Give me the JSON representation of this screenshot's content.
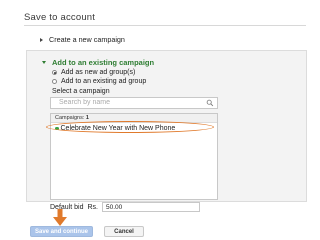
{
  "dialog": {
    "title": "Save to account"
  },
  "create": {
    "label": "Create a new campaign"
  },
  "existing": {
    "heading": "Add to an existing campaign",
    "options": [
      {
        "label": "Add as new ad group(s)",
        "selected": true
      },
      {
        "label": "Add to an existing ad group",
        "selected": false
      }
    ],
    "select_label": "Select a campaign",
    "search_placeholder": "Search by name",
    "list_header_label": "Campaigns:",
    "list_count": "1",
    "campaigns": [
      {
        "name": "Celebrate New Year with New Phone",
        "status_color": "#3aa142",
        "highlighted": true
      }
    ]
  },
  "bid": {
    "label": "Default bid",
    "currency": "Rs.",
    "value": "50.00"
  },
  "buttons": {
    "primary": "Save and continue",
    "secondary": "Cancel"
  },
  "annotation": {
    "arrow_icon": "down-arrow-icon",
    "color": "#e07a2c"
  }
}
